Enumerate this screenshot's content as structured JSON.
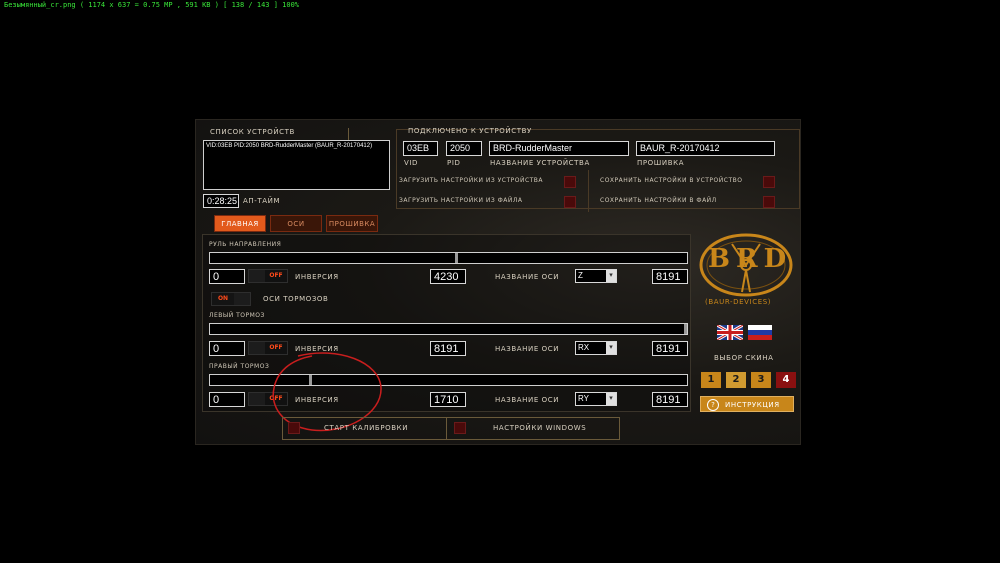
{
  "viewer_bar": "Безымянный_cr.png  ( 1174 x 637 = 0.75 MP  ,  591 KB )  [ 138 / 143 ]   100%",
  "devices": {
    "title": "Список устройств",
    "list_item": "VID:03EB PID:2050 BRD-RudderMaster (BAUR_R-20170412)",
    "uptime_value": "0:28:25",
    "uptime_label": "Ап-тайм"
  },
  "connected": {
    "title": "Подключено к устройству",
    "vid_value": "03EB",
    "vid_label": "VID",
    "pid_value": "2050",
    "pid_label": "PID",
    "name_value": "BRD-RudderMaster",
    "name_label": "Название устройства",
    "fw_value": "BAUR_R-20170412",
    "fw_label": "Прошивка",
    "load_from_device": "Загрузить настройки из устройства",
    "save_to_device": "Сохранить настройки в устройство",
    "load_from_file": "Загрузить настройки из файла",
    "save_to_file": "Сохранить настройки в файл"
  },
  "tabs": [
    "Главная",
    "Оси",
    "Прошивка"
  ],
  "rudder": {
    "title": "Руль направления",
    "min": "0",
    "toggle": "OFF",
    "inversion": "Инверсия",
    "value": "4230",
    "axis_label": "Название оси",
    "axis": "Z",
    "max": "8191",
    "position": 0.516
  },
  "brake_axes": {
    "toggle": "ON",
    "label": "Оси тормозов"
  },
  "left_brake": {
    "title": "Левый тормоз",
    "min": "0",
    "toggle": "OFF",
    "inversion": "Инверсия",
    "value": "8191",
    "axis_label": "Название оси",
    "axis": "RX",
    "max": "8191",
    "position": 1.0
  },
  "right_brake": {
    "title": "Правый тормоз",
    "min": "0",
    "toggle": "OFF",
    "inversion": "Инверсия",
    "value": "1710",
    "axis_label": "Название оси",
    "axis": "RY",
    "max": "8191",
    "position": 0.209
  },
  "bottom": {
    "calibration": "Старт калибровки",
    "windows": "Настройки Windows"
  },
  "brand": {
    "logo_text": "BRD",
    "caption": "(BAUR-DEVICES)"
  },
  "skin": {
    "label": "Выбор скина",
    "options": [
      "1",
      "2",
      "3",
      "4"
    ]
  },
  "help_button": "Инструкция",
  "colors": {
    "accent": "#c8861a",
    "tab_active": "#e25a1c",
    "annotation": "#c81e1e"
  }
}
